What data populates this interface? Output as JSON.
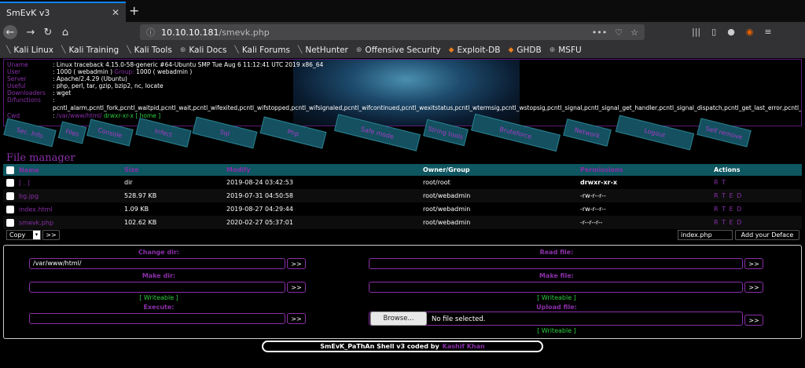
{
  "browser": {
    "tab_title": "SmEvK v3",
    "tab_close": "✕",
    "new_tab": "+",
    "url_host": "10.10.10.181",
    "url_path": "/smevk.php",
    "url_more": "•••",
    "bookmarks": [
      {
        "label": "Kali Linux",
        "icon": "kali-dragon-icon"
      },
      {
        "label": "Kali Training",
        "icon": "kali-dragon-icon"
      },
      {
        "label": "Kali Tools",
        "icon": "kali-dragon-icon"
      },
      {
        "label": "Kali Docs",
        "icon": "globe-icon"
      },
      {
        "label": "Kali Forums",
        "icon": "kali-dragon-icon"
      },
      {
        "label": "NetHunter",
        "icon": "kali-dragon-icon"
      },
      {
        "label": "Offensive Security",
        "icon": "globe-icon"
      },
      {
        "label": "Exploit-DB",
        "icon": "exploit-db-icon"
      },
      {
        "label": "GHDB",
        "icon": "exploit-db-icon"
      },
      {
        "label": "MSFU",
        "icon": "globe-icon"
      }
    ]
  },
  "info": {
    "uname_label": "Uname",
    "uname": ": Linux traceback 4.15.0-58-generic #64-Ubuntu SMP Tue Aug 6 11:12:41 UTC 2019 x86_64",
    "user_label": "User",
    "user": ": 1000 ( webadmin )",
    "group_label": "Group:",
    "group": "1000 ( webadmin )",
    "server_label": "Server",
    "server": ": Apache/2.4.29 (Ubuntu)",
    "useful_label": "Useful",
    "useful": ": php, perl, tar, gzip, bzip2, nc, locate",
    "downloaders_label": "Downloaders",
    "downloaders": ": wget",
    "dfunctions_label": "D/functions",
    "dfunctions_colon": ":",
    "dfunctions": "pcntl_alarm,pcntl_fork,pcntl_waitpid,pcntl_wait,pcntl_wifexited,pcntl_wifstopped,pcntl_wifsignaled,pcntl_wifcontinued,pcntl_wexitstatus,pcntl_wtermsig,pcntl_wstopsig,pcntl_signal,pcntl_signal_get_handler,pcntl_signal_dispatch,pcntl_get_last_error,pcntl_strerror,pcntl_sigprocmask,pcntl_sigwaitinfo,pcntl_sigtimedwait,pcntl_exec,pcntl_getpriority,pcntl_setpriority,pcntl_async_signals,",
    "cwd_label": "Cwd",
    "cwd_colon": ":",
    "cwd": "/var/www/html/",
    "cwd_perm": "drwxr-xr-x",
    "cwd_home": "[ home ]"
  },
  "menu": [
    "Sec. Info",
    "Files",
    "Console",
    "Infect",
    "Sql",
    "Php",
    "Safe mode",
    "String tools",
    "Bruteforce",
    "Network",
    "Logout",
    "Self remove"
  ],
  "file_manager": {
    "title": "File manager",
    "columns": [
      "Name",
      "Size",
      "Modify",
      "Owner/Group",
      "Permissions",
      "Actions"
    ],
    "rows": [
      {
        "name": "[ . ]",
        "size": "dir",
        "modify": "2019-08-24 03:42:53",
        "owner": "root/root",
        "perms": "drwxr-xr-x",
        "actions": "R T"
      },
      {
        "name": "bg.jpg",
        "size": "528.97 KB",
        "modify": "2019-07-31 04:50:58",
        "owner": "root/webadmin",
        "perms": "-rw-r--r--",
        "actions": "R T E D"
      },
      {
        "name": "index.html",
        "size": "1.09 KB",
        "modify": "2019-08-27 04:29:44",
        "owner": "root/webadmin",
        "perms": "-rw-r--r--",
        "actions": "R T E D"
      },
      {
        "name": "smevk.php",
        "size": "102.62 KB",
        "modify": "2020-02-27 05:37:01",
        "owner": "root/webadmin",
        "perms": "-r--r--r--",
        "actions": "R T E D"
      }
    ],
    "copy_label": "Copy",
    "go_label": ">>",
    "deface_value": "index.php",
    "deface_button": "Add your Deface"
  },
  "tools": {
    "change_dir_label": "Change dir:",
    "change_dir_value": "/var/www/html/",
    "read_file_label": "Read file:",
    "make_dir_label": "Make dir:",
    "make_file_label": "Make file:",
    "writeable": "[ Writeable ]",
    "execute_label": "Execute:",
    "upload_label": "Upload file:",
    "browse_label": "Browse...",
    "no_file": "No file selected.",
    "go": ">>"
  },
  "footer": {
    "text": "SmEvK_PaThAn Shell v3 coded by",
    "author": "Kashif Khan"
  },
  "colors": {
    "accent_purple": "#8a2fa8",
    "teal": "#0e5660",
    "green": "#2ecc40"
  }
}
